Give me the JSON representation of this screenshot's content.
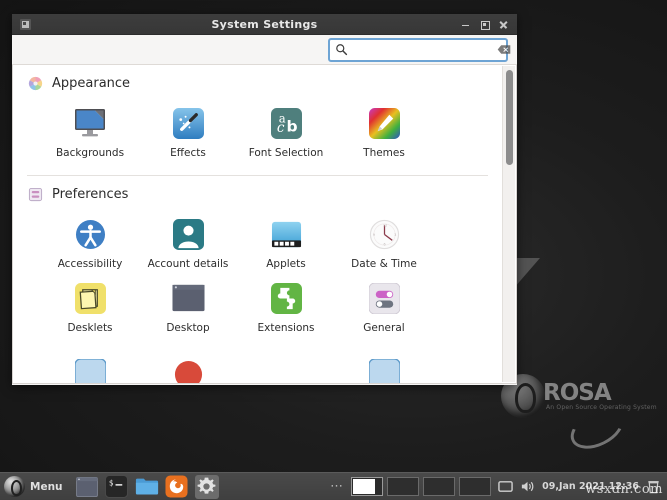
{
  "window": {
    "title": "System Settings",
    "icon": "window-icon",
    "buttons": {
      "minimize": "–",
      "maximize": "□",
      "close": "✕"
    }
  },
  "search": {
    "value": "",
    "placeholder": "",
    "icon": "search-icon",
    "clear_icon": "clear-icon"
  },
  "sections": [
    {
      "id": "appearance",
      "label": "Appearance",
      "icon": "color-wheel-icon",
      "tiles": [
        {
          "label": "Backgrounds",
          "icon": "monitor-wallpaper-icon"
        },
        {
          "label": "Effects",
          "icon": "magic-wand-icon"
        },
        {
          "label": "Font Selection",
          "icon": "font-abc-icon"
        },
        {
          "label": "Themes",
          "icon": "paintbrush-rainbow-icon"
        }
      ]
    },
    {
      "id": "preferences",
      "label": "Preferences",
      "icon": "preferences-list-icon",
      "tiles": [
        {
          "label": "Accessibility",
          "icon": "accessibility-icon"
        },
        {
          "label": "Account details",
          "icon": "user-avatar-icon"
        },
        {
          "label": "Applets",
          "icon": "applets-panel-icon"
        },
        {
          "label": "Date & Time",
          "icon": "clock-icon"
        },
        {
          "label": "Desklets",
          "icon": "sticky-notes-icon"
        },
        {
          "label": "Desktop",
          "icon": "desktop-window-icon"
        },
        {
          "label": "Extensions",
          "icon": "puzzle-piece-icon"
        },
        {
          "label": "General",
          "icon": "toggle-switches-icon"
        }
      ]
    }
  ],
  "scrollbar": {
    "thumb_position": "top"
  },
  "taskbar": {
    "menu_label": "Menu",
    "menu_icon": "mint-menu-icon",
    "launchers": [
      {
        "name": "show-desktop",
        "icon": "window-tile-icon",
        "active": false
      },
      {
        "name": "terminal",
        "icon": "terminal-icon",
        "active": false
      },
      {
        "name": "file-manager",
        "icon": "folder-icon",
        "active": false
      },
      {
        "name": "firefox",
        "icon": "firefox-icon",
        "active": false
      },
      {
        "name": "system-settings",
        "icon": "gear-icon",
        "active": true
      }
    ],
    "overflow_icon": "overflow-dots-icon",
    "workspaces": [
      {
        "name": "workspace-1",
        "active": true
      },
      {
        "name": "workspace-2",
        "active": false
      },
      {
        "name": "workspace-3",
        "active": false
      },
      {
        "name": "workspace-4",
        "active": false
      }
    ],
    "tray": [
      {
        "name": "display-icon"
      },
      {
        "name": "volume-icon"
      }
    ],
    "clock": "09,Jan 2021 12:36",
    "trash_icon": "trash-icon"
  },
  "desktop": {
    "logo_wordmark": "ROSA",
    "logo_tagline": "An Open Source Operating System"
  },
  "watermark": "wsxdn.com",
  "colors": {
    "titlebar": "#3a3a3a",
    "window_bg": "#f6f5f4",
    "content_bg": "#ffffff",
    "search_border": "#6ea4d4",
    "taskbar": "#454545",
    "accent_blue": "#4a86c8"
  }
}
